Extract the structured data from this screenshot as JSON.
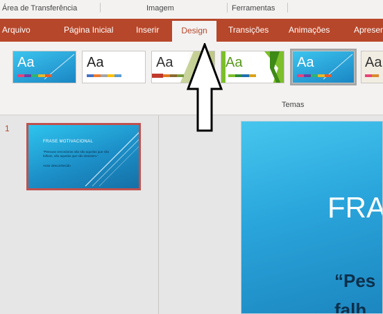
{
  "ribbon_groups": [
    "Área de Transferência",
    "Imagem",
    "Ferramentas"
  ],
  "tabs": [
    {
      "label": "Arquivo",
      "active": false
    },
    {
      "label": "Página Inicial",
      "active": false
    },
    {
      "label": "Inserir",
      "active": false
    },
    {
      "label": "Design",
      "active": true
    },
    {
      "label": "Transições",
      "active": false
    },
    {
      "label": "Animações",
      "active": false
    },
    {
      "label": "Apresen",
      "active": false
    }
  ],
  "themes": {
    "group_label": "Temas",
    "thumbnail_text": "Aa",
    "selected_index": 5
  },
  "slides_pane": {
    "slide_number": "1",
    "thumb_title": "FRASE MOTIVACIONAL",
    "thumb_body": "\"Pessoas vencedoras não são aquelas que não falham, são aquelas que não desistem.\"",
    "thumb_author": "Autor desconhecido"
  },
  "main_slide": {
    "title": "FRA",
    "body_line1": "“Pes",
    "body_line2": "falh"
  },
  "colors": {
    "accent": "#b7472a",
    "ribbon_bg": "#f3f2f1",
    "slide_blue": "#2aa6dc"
  }
}
